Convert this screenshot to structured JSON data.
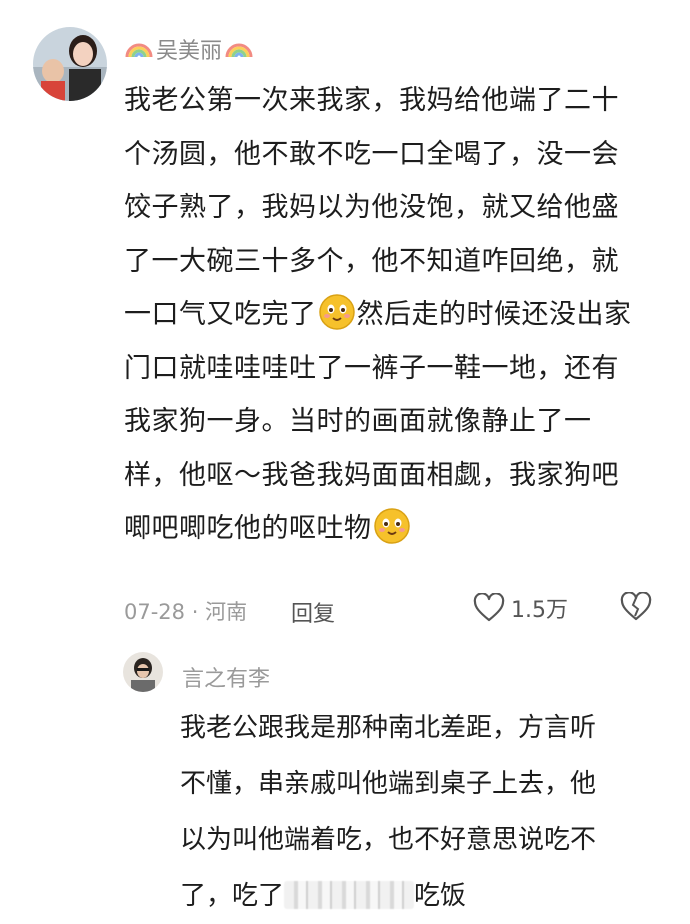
{
  "comment": {
    "username": "吴美丽",
    "lines": [
      "我老公第一次来我家，我妈给他端了二十",
      "个汤圆，他不敢不吃一口全喝了，没一会",
      "饺子熟了，我妈以为他没饱，就又给他盛",
      "了一大碗三十多个，他不知道咋回绝，就",
      "一口气又吃完了",
      "然后走的时候还没出家",
      "门口就哇哇哇吐了一裤子一鞋一地，还有",
      "我家狗一身。当时的画面就像静止了一",
      "样，他呕～我爸我妈面面相觑，我家狗吧",
      "唧吧唧吃他的呕吐物"
    ],
    "date": "07-28",
    "location": "河南",
    "reply_label": "回复",
    "like_count": "1.5万"
  },
  "reply": {
    "username": "言之有李",
    "lines": [
      "我老公跟我是那种南北差距，方言听",
      "不懂，串亲戚叫他端到桌子上去，他",
      "以为叫他端着吃，也不好意思说吃不",
      "了，吃了",
      "吃饭"
    ]
  },
  "colors": {
    "meta": "#9a9a9a",
    "text": "#1d1d1d",
    "emoji": "#f6c12b"
  },
  "icons": [
    "rainbow-icon",
    "smile-emoji-icon",
    "heart-icon",
    "broken-heart-icon"
  ]
}
